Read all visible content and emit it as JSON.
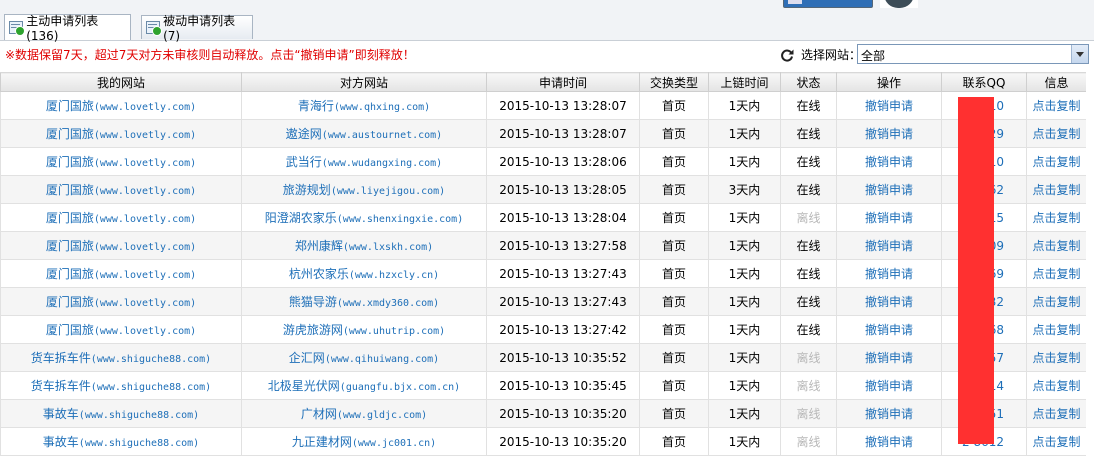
{
  "tabs": [
    {
      "label": "主动申请列表(136)"
    },
    {
      "label": "被动申请列表(7)"
    }
  ],
  "notice": "※数据保留7天，超过7天对方未审核则自动释放。点击“撤销申请”即刻释放！",
  "site_filter": {
    "label": "选择网站：",
    "value": "全部"
  },
  "columns": [
    "我的网站",
    "对方网站",
    "申请时间",
    "交换类型",
    "上链时间",
    "状态",
    "操作",
    "联系QQ",
    "信息"
  ],
  "rows": [
    {
      "my_name": "厦门国旅",
      "my_domain": "(www.lovetly.com)",
      "peer_name": "青海行",
      "peer_domain": "(www.qhxing.com)",
      "time": "2015-10-13 13:28:07",
      "type": "首页",
      "link_time": "1天内",
      "status": "在线",
      "status_on": true,
      "action": "撤销申请",
      "qq": "010",
      "info": "点击复制"
    },
    {
      "my_name": "厦门国旅",
      "my_domain": "(www.lovetly.com)",
      "peer_name": "遨途网",
      "peer_domain": "(www.austournet.com)",
      "time": "2015-10-13 13:28:07",
      "type": "首页",
      "link_time": "1天内",
      "status": "在线",
      "status_on": true,
      "action": "撤销申请",
      "qq": "029",
      "info": "点击复制"
    },
    {
      "my_name": "厦门国旅",
      "my_domain": "(www.lovetly.com)",
      "peer_name": "武当行",
      "peer_domain": "(www.wudangxing.com)",
      "time": "2015-10-13 13:28:06",
      "type": "首页",
      "link_time": "1天内",
      "status": "在线",
      "status_on": true,
      "action": "撤销申请",
      "qq": "010",
      "info": "点击复制"
    },
    {
      "my_name": "厦门国旅",
      "my_domain": "(www.lovetly.com)",
      "peer_name": "旅游规划",
      "peer_domain": "(www.liyejigou.com)",
      "time": "2015-10-13 13:28:05",
      "type": "首页",
      "link_time": "3天内",
      "status": "在线",
      "status_on": true,
      "action": "撤销申请",
      "qq": "962",
      "info": "点击复制"
    },
    {
      "my_name": "厦门国旅",
      "my_domain": "(www.lovetly.com)",
      "peer_name": "阳澄湖农家乐",
      "peer_domain": "(www.shenxingxie.com)",
      "time": "2015-10-13 13:28:04",
      "type": "首页",
      "link_time": "1天内",
      "status": "离线",
      "status_on": false,
      "action": "撤销申请",
      "qq": "315",
      "info": "点击复制"
    },
    {
      "my_name": "厦门国旅",
      "my_domain": "(www.lovetly.com)",
      "peer_name": "郑州康辉",
      "peer_domain": "(www.lxskh.com)",
      "time": "2015-10-13 13:27:58",
      "type": "首页",
      "link_time": "1天内",
      "status": "在线",
      "status_on": true,
      "action": "撤销申请",
      "qq": "409",
      "info": "点击复制"
    },
    {
      "my_name": "厦门国旅",
      "my_domain": "(www.lovetly.com)",
      "peer_name": "杭州农家乐",
      "peer_domain": "(www.hzxcly.cn)",
      "time": "2015-10-13 13:27:43",
      "type": "首页",
      "link_time": "1天内",
      "status": "在线",
      "status_on": true,
      "action": "撤销申请",
      "qq": "569",
      "info": "点击复制"
    },
    {
      "my_name": "厦门国旅",
      "my_domain": "(www.lovetly.com)",
      "peer_name": "熊猫导游",
      "peer_domain": "(www.xmdy360.com)",
      "time": "2015-10-13 13:27:43",
      "type": "首页",
      "link_time": "1天内",
      "status": "在线",
      "status_on": true,
      "action": "撤销申请",
      "qq": "332",
      "info": "点击复制"
    },
    {
      "my_name": "厦门国旅",
      "my_domain": "(www.lovetly.com)",
      "peer_name": "游虎旅游网",
      "peer_domain": "(www.uhutrip.com)",
      "time": "2015-10-13 13:27:42",
      "type": "首页",
      "link_time": "1天内",
      "status": "在线",
      "status_on": true,
      "action": "撤销申请",
      "qq": "1 268",
      "info": "点击复制"
    },
    {
      "my_name": "货车拆车件",
      "my_domain": "(www.shiguche88.com)",
      "peer_name": "企汇网",
      "peer_domain": "(www.qihuiwang.com)",
      "time": "2015-10-13 10:35:52",
      "type": "首页",
      "link_time": "1天内",
      "status": "离线",
      "status_on": false,
      "action": "撤销申请",
      "qq": "1 257",
      "info": "点击复制"
    },
    {
      "my_name": "货车拆车件",
      "my_domain": "(www.shiguche88.com)",
      "peer_name": "北极星光伏网",
      "peer_domain": "(guangfu.bjx.com.cn)",
      "time": "2015-10-13 10:35:45",
      "type": "首页",
      "link_time": "1天内",
      "status": "离线",
      "status_on": false,
      "action": "撤销申请",
      "qq": "114",
      "info": "点击复制"
    },
    {
      "my_name": "事故车",
      "my_domain": "(www.shiguche88.com)",
      "peer_name": "广材网",
      "peer_domain": "(www.gldjc.com)",
      "time": "2015-10-13 10:35:20",
      "type": "首页",
      "link_time": "1天内",
      "status": "离线",
      "status_on": false,
      "action": "撤销申请",
      "qq": "2 651",
      "info": "点击复制"
    },
    {
      "my_name": "事故车",
      "my_domain": "(www.shiguche88.com)",
      "peer_name": "九正建材网",
      "peer_domain": "(www.jc001.cn)",
      "time": "2015-10-13 10:35:20",
      "type": "首页",
      "link_time": "1天内",
      "status": "离线",
      "status_on": false,
      "action": "撤销申请",
      "qq": "2 8612",
      "info": "点击复制"
    }
  ]
}
